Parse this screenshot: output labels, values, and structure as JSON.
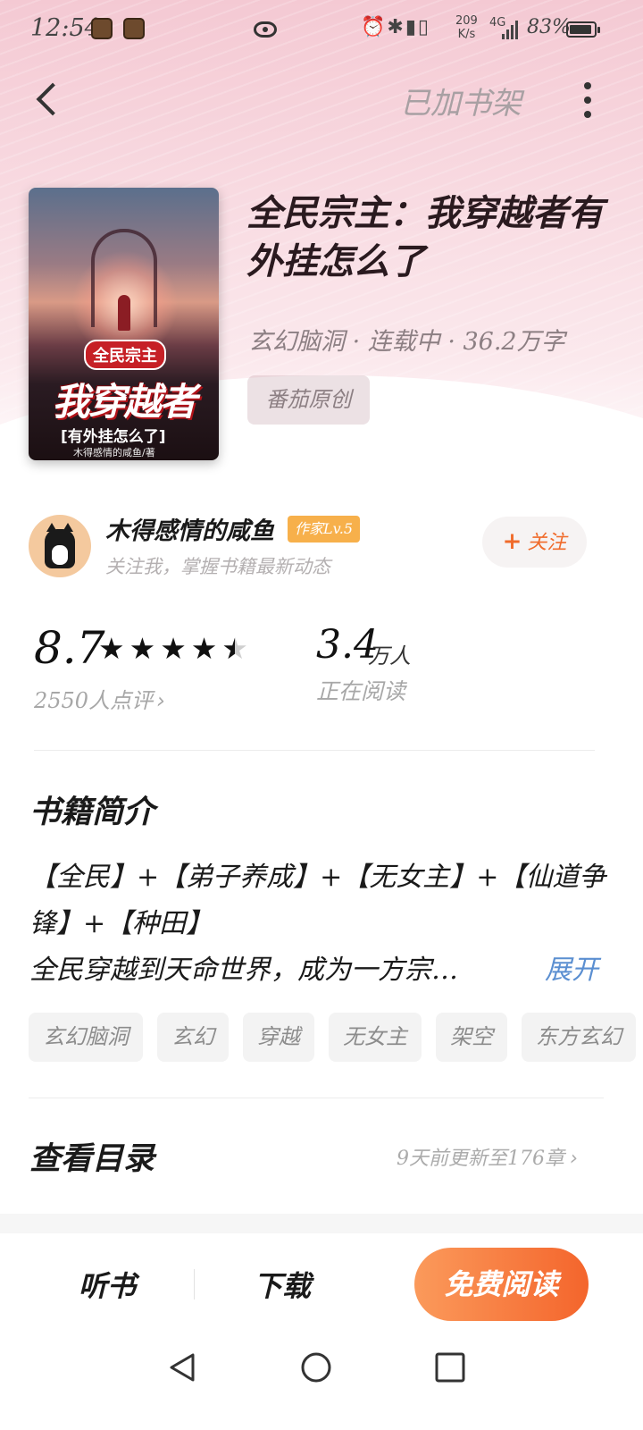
{
  "status_bar": {
    "time": "12:54",
    "net_speed_value": "209",
    "net_speed_unit": "K/s",
    "signal": "4G",
    "battery": "83%"
  },
  "nav": {
    "back_icon": "chevron-left-icon",
    "shelf_state": "已加书架",
    "more_icon": "more-vertical-icon"
  },
  "book": {
    "title": "全民宗主：我穿越者有外挂怎么了",
    "meta": "玄幻脑洞 · 连载中 · 36.2万字",
    "origin": "番茄原创",
    "cover": {
      "tag": "全民宗主",
      "big": "我穿越者",
      "sub": "[有外挂怎么了]",
      "author": "木得感情的咸鱼/著"
    }
  },
  "author": {
    "name": "木得感情的咸鱼",
    "level": "作家Lv.5",
    "tip": "关注我，掌握书籍最新动态",
    "follow_plus": "+",
    "follow_label": "关注"
  },
  "stats": {
    "score": "8.7",
    "stars": 4.5,
    "rating_count": "2550人点评",
    "rating_chevron": "›",
    "reading_value": "3.4",
    "reading_unit": "万人",
    "reading_label": "正在阅读"
  },
  "synopsis": {
    "title": "书籍简介",
    "line1": "【全民】+【弟子养成】+【无女主】+【仙道争锋】+【种田】",
    "line2": "全民穿越到天命世界，成为一方宗…",
    "expand": "展开",
    "tags": [
      "玄幻脑洞",
      "玄幻",
      "穿越",
      "无女主",
      "架空",
      "东方玄幻"
    ]
  },
  "toc": {
    "title": "查看目录",
    "update": "9天前更新至176章",
    "chevron": "›"
  },
  "actions": {
    "listen": "听书",
    "download": "下载",
    "read": "免费阅读"
  },
  "colors": {
    "accent": "#f4652c",
    "link": "#5b8fd1",
    "level_badge": "#f7b04b"
  }
}
